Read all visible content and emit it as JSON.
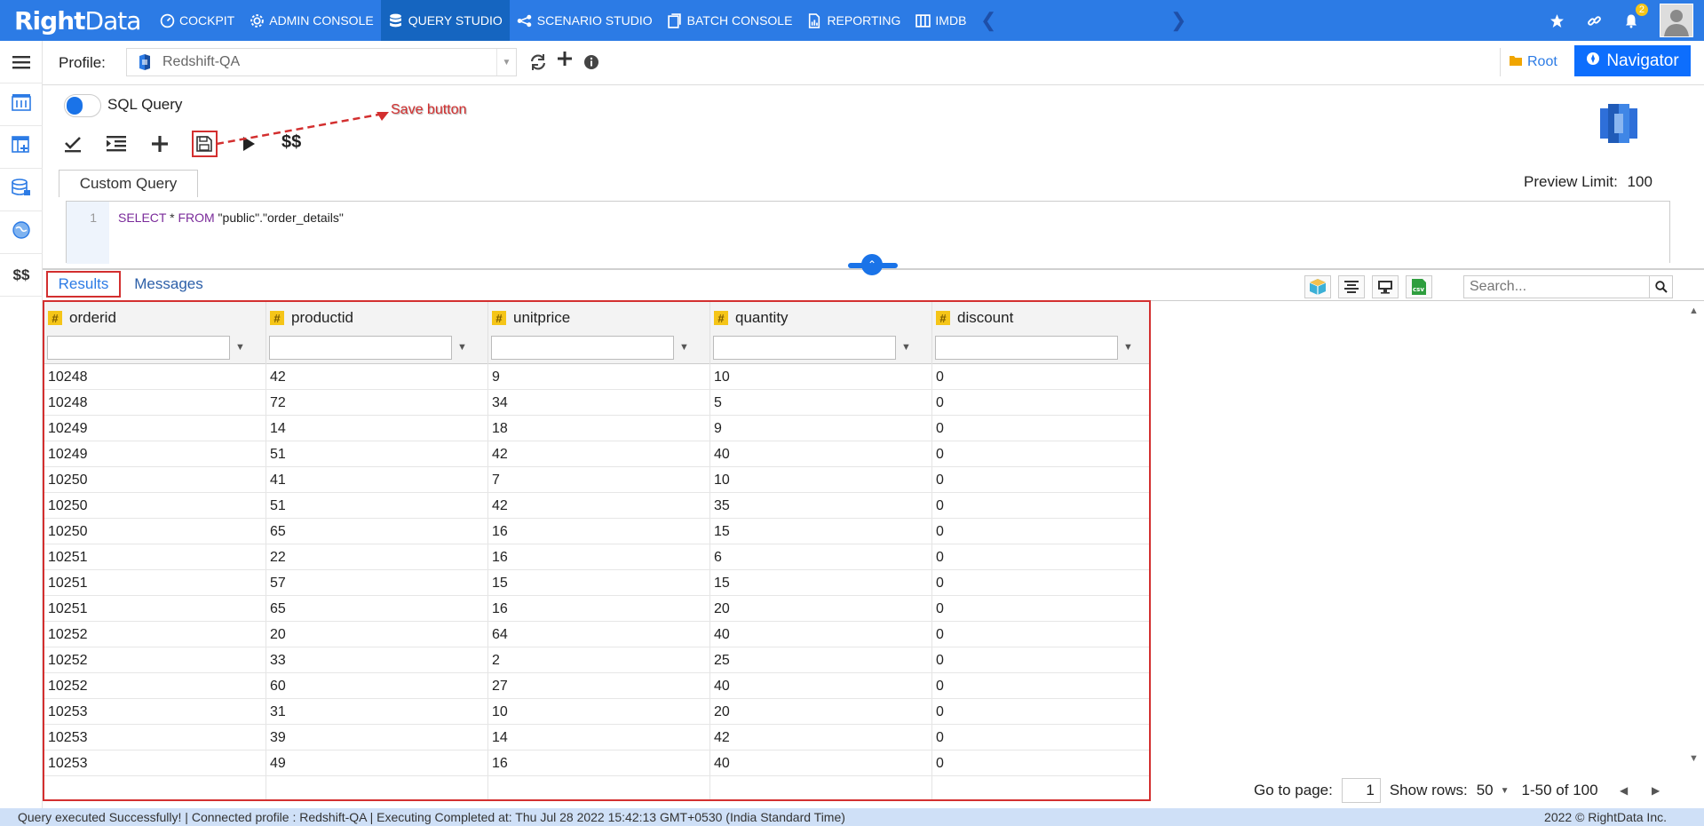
{
  "app": {
    "logo_text_a": "Right",
    "logo_text_b": "Data",
    "nav": [
      {
        "label": "COCKPIT",
        "icon": "dashboard-icon"
      },
      {
        "label": "ADMIN CONSOLE",
        "icon": "gear-icon"
      },
      {
        "label": "QUERY STUDIO",
        "icon": "database-icon"
      },
      {
        "label": "SCENARIO STUDIO",
        "icon": "workflow-icon"
      },
      {
        "label": "BATCH CONSOLE",
        "icon": "batch-icon"
      },
      {
        "label": "REPORTING",
        "icon": "report-icon"
      },
      {
        "label": "IMDB",
        "icon": "columns-icon"
      }
    ],
    "notification_count": "2"
  },
  "profile": {
    "label": "Profile:",
    "value": "Redshift-QA",
    "root_label": "Root",
    "navigator_label": "Navigator"
  },
  "query": {
    "mode_label": "SQL Query",
    "annotation": "Save button",
    "dollars_label": "$$",
    "tab_label": "Custom Query",
    "preview_label": "Preview Limit:",
    "preview_value": "100",
    "line_number": "1",
    "sql_kw1": "SELECT",
    "sql_star": " * ",
    "sql_kw2": "FROM",
    "sql_rest": " \"public\".\"order_details\""
  },
  "sidebar": {
    "dollars": "$$"
  },
  "results": {
    "tab_results": "Results",
    "tab_messages": "Messages",
    "search_placeholder": "Search...",
    "columns": [
      "orderid",
      "productid",
      "unitprice",
      "quantity",
      "discount"
    ],
    "rows": [
      [
        "10248",
        "42",
        "9",
        "10",
        "0"
      ],
      [
        "10248",
        "72",
        "34",
        "5",
        "0"
      ],
      [
        "10249",
        "14",
        "18",
        "9",
        "0"
      ],
      [
        "10249",
        "51",
        "42",
        "40",
        "0"
      ],
      [
        "10250",
        "41",
        "7",
        "10",
        "0"
      ],
      [
        "10250",
        "51",
        "42",
        "35",
        "0"
      ],
      [
        "10250",
        "65",
        "16",
        "15",
        "0"
      ],
      [
        "10251",
        "22",
        "16",
        "6",
        "0"
      ],
      [
        "10251",
        "57",
        "15",
        "15",
        "0"
      ],
      [
        "10251",
        "65",
        "16",
        "20",
        "0"
      ],
      [
        "10252",
        "20",
        "64",
        "40",
        "0"
      ],
      [
        "10252",
        "33",
        "2",
        "25",
        "0"
      ],
      [
        "10252",
        "60",
        "27",
        "40",
        "0"
      ],
      [
        "10253",
        "31",
        "10",
        "20",
        "0"
      ],
      [
        "10253",
        "39",
        "14",
        "42",
        "0"
      ],
      [
        "10253",
        "49",
        "16",
        "40",
        "0"
      ]
    ]
  },
  "pager": {
    "goto_label": "Go to page:",
    "page_value": "1",
    "show_rows_label": "Show rows:",
    "rows_value": "50",
    "range_label": "1-50 of 100"
  },
  "status": {
    "message": "Query executed Successfully! | Connected profile : Redshift-QA | Executing Completed at: Thu Jul 28 2022 15:42:13 GMT+0530 (India Standard Time)",
    "copyright": "2022 © RightData Inc."
  },
  "colors": {
    "brand": "#2c7be5",
    "active_nav": "#1565c0",
    "highlight": "#d32f2f"
  }
}
